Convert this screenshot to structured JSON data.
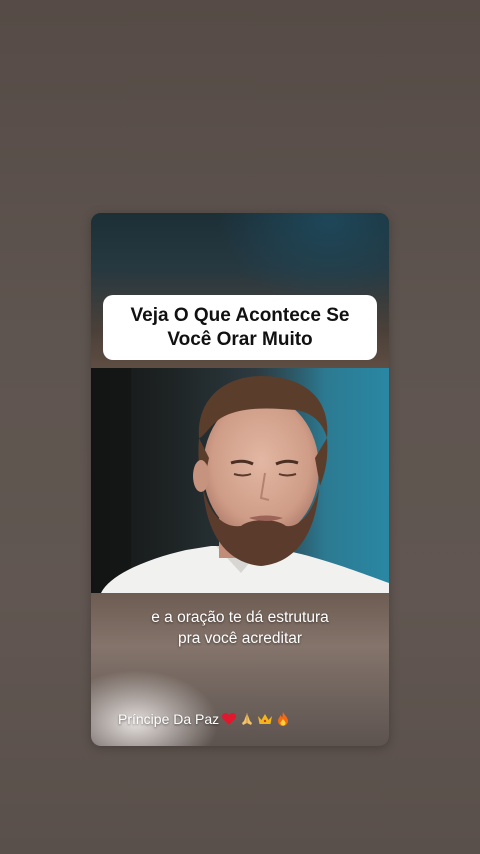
{
  "video": {
    "title_line1": "Veja O Que Acontece Se",
    "title_line2": "Você Orar Muito",
    "caption_line1": "e a oração te dá estrutura",
    "caption_line2": "pra você acreditar",
    "channel_name": "Príncipe Da Paz",
    "channel_emojis": [
      "heart-icon",
      "praying-hands-icon",
      "crown-icon",
      "fire-icon"
    ]
  },
  "colors": {
    "background": "#5f5550",
    "title_box": "#ffffff",
    "heart": "#e0182d",
    "crown": "#f2b619",
    "fire": "#f46a10"
  }
}
